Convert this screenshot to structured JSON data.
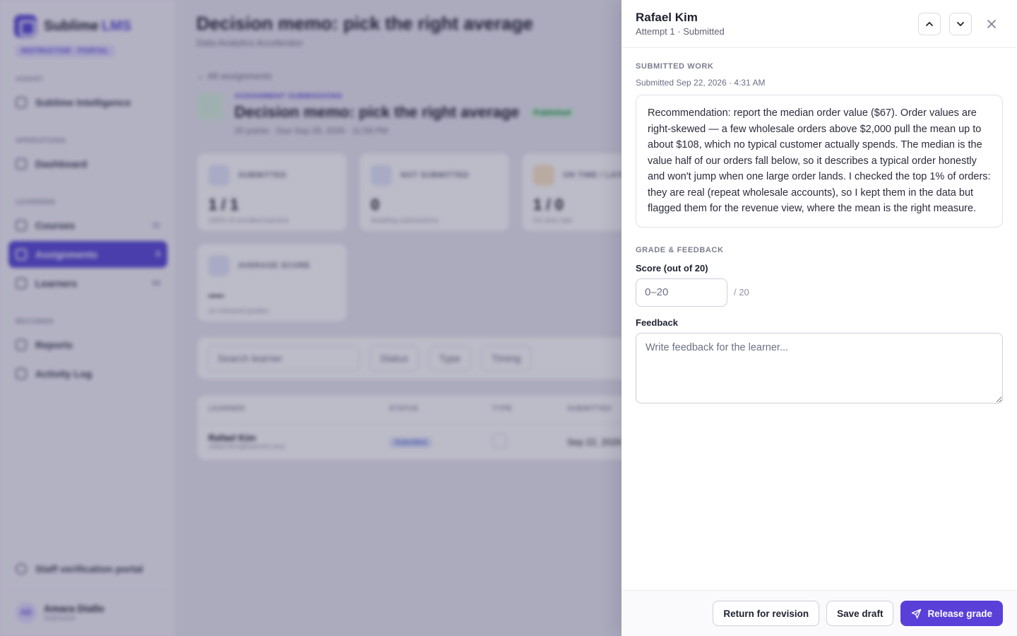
{
  "background": {
    "brand": {
      "name": "Sublime",
      "accent": "LMS",
      "portal_badge": "INSTRUCTOR · PORTAL"
    },
    "nav_sections": {
      "assist": "ASSIST",
      "operations": "OPERATIONS",
      "learning": "LEARNING",
      "records": "RECORDS"
    },
    "nav_items": {
      "intelligence": {
        "label": "Sublime Intelligence",
        "icon": "sparkle-icon"
      },
      "dashboard": {
        "label": "Dashboard",
        "icon": "grid-icon"
      },
      "courses": {
        "label": "Courses",
        "count": "11"
      },
      "assignments": {
        "label": "Assignments",
        "count": "5"
      },
      "learners": {
        "label": "Learners",
        "count": "34"
      },
      "reports": {
        "label": "Reports"
      },
      "activity": {
        "label": "Activity Log"
      }
    },
    "staff_link": "Staff verification portal",
    "user": {
      "initials": "AD",
      "name": "Amara Diallo",
      "role": "Instructor"
    },
    "page_title": "Decision memo: pick the right average",
    "page_subtitle": "Data Analytics Accelerator",
    "back_link": "All assignments",
    "assignment": {
      "kicker": "ASSIGNMENT SUBMISSIONS",
      "title": "Decision memo: pick the right average",
      "status": "Published",
      "meta": "20 points · Due Sep 28, 2026 · 11:59 PM"
    },
    "stats": [
      {
        "label": "SUBMITTED",
        "value": "1 / 1",
        "note": "100% of enrolled learners"
      },
      {
        "label": "NOT SUBMITTED",
        "value": "0",
        "note": "Awaiting submissions"
      },
      {
        "label": "ON TIME / LATE",
        "value": "1 / 0",
        "note": "On time rate"
      },
      {
        "label": "AVERAGE SCORE",
        "value": "—",
        "note": "no released grades"
      }
    ],
    "filters": {
      "search_placeholder": "Search learner",
      "status": "Status",
      "type": "Type",
      "time": "Timing"
    },
    "table": {
      "headers": [
        "LEARNER",
        "STATUS",
        "TYPE",
        "SUBMITTED"
      ],
      "rows": [
        {
          "name": "Rafael Kim",
          "email": "rafael.kim@learners.test",
          "status": "Submitted",
          "submitted": "Sep 22, 2026"
        }
      ]
    }
  },
  "drawer": {
    "learner_name": "Rafael Kim",
    "attempt_line": "Attempt 1 · Submitted",
    "submitted_work_label": "SUBMITTED WORK",
    "submitted_at": "Submitted Sep 22, 2026 · 4:31 AM",
    "answer_text": "Recommendation: report the median order value ($67). Order values are right-skewed — a few wholesale orders above $2,000 pull the mean up to about $108, which no typical customer actually spends. The median is the value half of our orders fall below, so it describes a typical order honestly and won't jump when one large order lands. I checked the top 1% of orders: they are real (repeat wholesale accounts), so I kept them in the data but flagged them for the revenue view, where the mean is the right measure.",
    "grade_section_label": "GRADE & FEEDBACK",
    "score_label": "Score (out of 20)",
    "score_placeholder": "0–20",
    "score_value": "",
    "score_suffix": "/ 20",
    "feedback_label": "Feedback",
    "feedback_placeholder": "Write feedback for the learner...",
    "feedback_value": "",
    "buttons": {
      "return": "Return for revision",
      "save": "Save draft",
      "release": "Release grade"
    }
  },
  "colors": {
    "accent": "#5b3fd9",
    "overlay": "rgba(34,30,72,0.30)"
  }
}
